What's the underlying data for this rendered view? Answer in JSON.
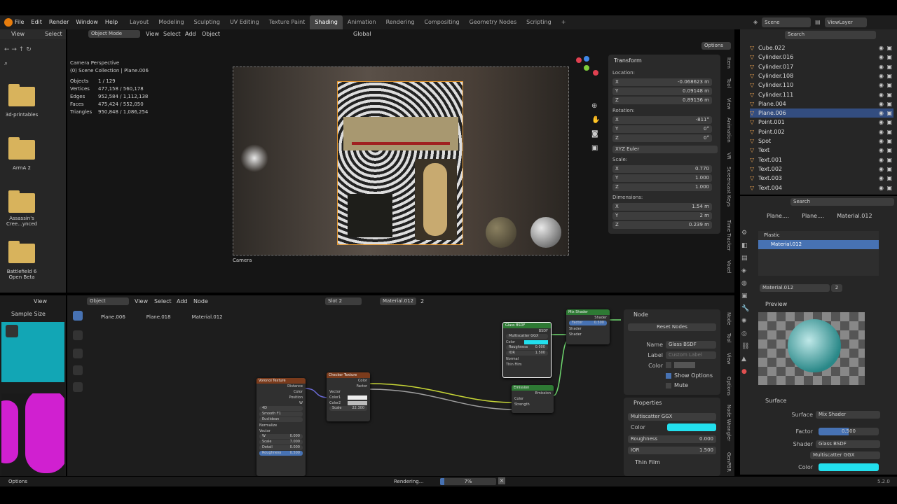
{
  "menu": [
    "File",
    "Edit",
    "Render",
    "Window",
    "Help"
  ],
  "workspaces": [
    "Layout",
    "Modeling",
    "Sculpting",
    "UV Editing",
    "Texture Paint",
    "Shading",
    "Animation",
    "Rendering",
    "Compositing",
    "Geometry Nodes",
    "Scripting",
    "+"
  ],
  "active_workspace": "Shading",
  "scene": "Scene",
  "view_layer": "ViewLayer",
  "filebrowser": {
    "view": "View",
    "select": "Select",
    "folders": [
      "3d-printables",
      "ArmA 2",
      "Assassin's Cree...ynced",
      "Battlefield 6 Open Beta"
    ]
  },
  "viewport": {
    "mode": "Object Mode",
    "menus": [
      "View",
      "Select",
      "Add",
      "Object"
    ],
    "orientation": "Global",
    "options": "Options",
    "title": "Camera Perspective",
    "collection": "(0) Scene Collection | Plane.006",
    "stats": [
      {
        "k": "Objects",
        "v": "1 / 129"
      },
      {
        "k": "Vertices",
        "v": "477,158 / 560,178"
      },
      {
        "k": "Edges",
        "v": "952,584 / 1,112,138"
      },
      {
        "k": "Faces",
        "v": "475,424 / 552,050"
      },
      {
        "k": "Triangles",
        "v": "950,848 / 1,086,254"
      }
    ],
    "camera_label": "Camera"
  },
  "transform": {
    "title": "Transform",
    "location_label": "Location:",
    "location": [
      "-0.068623 m",
      "0.09148 m",
      "0.89136 m"
    ],
    "rotation_label": "Rotation:",
    "rotation": [
      "-811°",
      "0°",
      "0°"
    ],
    "rotation_mode": "XYZ Euler",
    "scale_label": "Scale:",
    "scale": [
      "0.770",
      "1.000",
      "1.000"
    ],
    "dimensions_label": "Dimensions:",
    "dimensions": [
      "1.54 m",
      "2 m",
      "0.239 m"
    ],
    "axes": [
      "X",
      "Y",
      "Z"
    ]
  },
  "side_tabs": [
    "Item",
    "Tool",
    "View",
    "Animation",
    "VR",
    "Screencast Keys",
    "Time Tracker",
    "Voxel"
  ],
  "outliner": {
    "search": "Search",
    "items": [
      {
        "name": "Cube.022",
        "sel": false
      },
      {
        "name": "Cylinder.016",
        "sel": false
      },
      {
        "name": "Cylinder.017",
        "sel": false
      },
      {
        "name": "Cylinder.108",
        "sel": false
      },
      {
        "name": "Cylinder.110",
        "sel": false
      },
      {
        "name": "Cylinder.111",
        "sel": false
      },
      {
        "name": "Plane.004",
        "sel": false
      },
      {
        "name": "Plane.006",
        "sel": true
      },
      {
        "name": "Point.001",
        "sel": false
      },
      {
        "name": "Point.002",
        "sel": false
      },
      {
        "name": "Spot",
        "sel": false
      },
      {
        "name": "Text",
        "sel": false
      },
      {
        "name": "Text.001",
        "sel": false
      },
      {
        "name": "Text.002",
        "sel": false
      },
      {
        "name": "Text.003",
        "sel": false
      },
      {
        "name": "Text.004",
        "sel": false
      }
    ]
  },
  "properties": {
    "search": "Search",
    "breadcrumb": [
      "Plane....",
      "Plane....",
      "Material.012"
    ],
    "slots": [
      "Plastic",
      "Material.012"
    ],
    "material": "Material.012",
    "users": "2",
    "preview": "Preview",
    "surface_section": "Surface",
    "surface": {
      "label": "Surface",
      "value": "Mix Shader"
    },
    "factor": {
      "label": "Factor",
      "value": "0.500",
      "fraction": 0.5
    },
    "shader": {
      "label": "Shader",
      "value": "Glass BSDF"
    },
    "distribution": "Multiscatter GGX",
    "color_label": "Color",
    "color": "#22e0ee"
  },
  "node_editor": {
    "object_mode": "Object",
    "menus": [
      "View",
      "Select",
      "Add",
      "Node"
    ],
    "slot": "Slot 2",
    "material": "Material.012",
    "users": "2",
    "breadcrumb": [
      "Plane.006",
      "Plane.018",
      "Material.012"
    ],
    "sidebar_tabs": [
      "Node",
      "Tool",
      "View",
      "Options",
      "Node Wrangler",
      "GenPBR"
    ],
    "node_panel": {
      "title": "Node",
      "reset": "Reset Nodes",
      "name_label": "Name",
      "name": "Glass BSDF",
      "label_label": "Label",
      "label_placeholder": "Custom Label",
      "color_label": "Color",
      "show_options": "Show Options",
      "mute": "Mute"
    },
    "props_panel": {
      "title": "Properties",
      "distribution": "Multiscatter GGX",
      "color_label": "Color",
      "roughness_label": "Roughness",
      "roughness": "0.000",
      "ior_label": "IOR",
      "ior": "1.500",
      "thin_film": "Thin Film"
    },
    "nodes": {
      "voronoi": {
        "title": "Voronoi Texture",
        "outs": [
          "Distance",
          "Color",
          "Position",
          "W"
        ],
        "dims": "4D",
        "feature": "Smooth F1",
        "metric": "Euclidean",
        "normalize": "Normalize",
        "vector": "Vector",
        "w": {
          "k": "W",
          "v": "0.000"
        },
        "scale": {
          "k": "Scale",
          "v": "7.000"
        },
        "detail": {
          "k": "Detail",
          "v": "0.000"
        },
        "rough": {
          "k": "Roughness",
          "v": "0.500"
        }
      },
      "checker": {
        "title": "Checker Texture",
        "outs": [
          "Color",
          "Factor"
        ],
        "vector": "Vector",
        "color1": "Color1",
        "color2": "Color2",
        "scale": {
          "k": "Scale",
          "v": "22.300"
        }
      },
      "glass": {
        "title": "Glass BSDF",
        "out": "BSDF",
        "dist": "Multiscatter GGX",
        "color": "Color",
        "rough": {
          "k": "Roughness",
          "v": "0.000"
        },
        "ior": {
          "k": "IOR",
          "v": "1.500"
        },
        "normal": "Normal",
        "thin": "Thin Film"
      },
      "emission": {
        "title": "Emission",
        "out": "Emission",
        "color": "Color",
        "strength": "Strength"
      },
      "mix": {
        "title": "Mix Shader",
        "out": "Shader",
        "factor": {
          "k": "Factor",
          "v": "0.500"
        },
        "shader1": "Shader",
        "shader2": "Shader"
      }
    }
  },
  "image_editor": {
    "view": "View",
    "sample_size": "Sample Size"
  },
  "status": {
    "options": "Options",
    "rendering": "Rendering...",
    "progress": "7%",
    "progress_fraction": 0.07,
    "version": "5.2.0"
  }
}
